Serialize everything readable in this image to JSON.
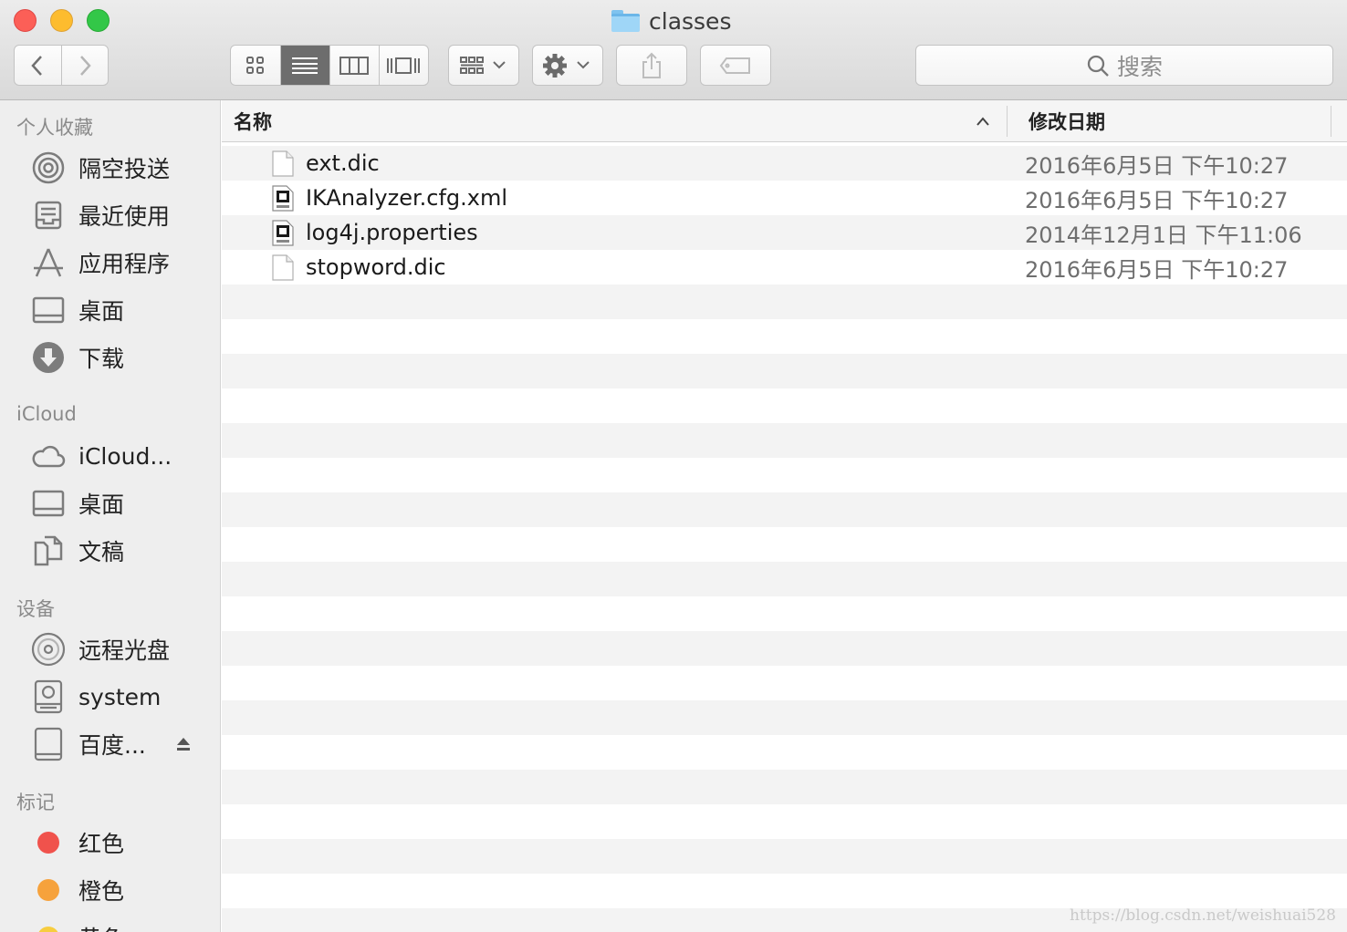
{
  "window": {
    "title": "classes"
  },
  "toolbar": {
    "back_icon": "chevron-left-icon",
    "forward_icon": "chevron-right-icon",
    "view_modes": [
      "icon-view",
      "list-view",
      "column-view",
      "cover-flow-view"
    ],
    "active_view": "list-view",
    "arrange_icon": "arrange-grid-icon",
    "action_icon": "gear-icon",
    "share_icon": "share-icon",
    "tag_icon": "tag-icon",
    "search_placeholder": "搜索"
  },
  "sidebar": {
    "favorites_title": "个人收藏",
    "favorites": [
      {
        "label": "隔空投送",
        "icon": "airdrop-icon"
      },
      {
        "label": "最近使用",
        "icon": "recents-icon"
      },
      {
        "label": "应用程序",
        "icon": "applications-icon"
      },
      {
        "label": "桌面",
        "icon": "desktop-icon"
      },
      {
        "label": "下载",
        "icon": "downloads-icon"
      }
    ],
    "icloud_title": "iCloud",
    "icloud": [
      {
        "label": "iCloud...",
        "icon": "icloud-icon"
      },
      {
        "label": "桌面",
        "icon": "desktop-icon"
      },
      {
        "label": "文稿",
        "icon": "documents-icon"
      }
    ],
    "devices_title": "设备",
    "devices": [
      {
        "label": "远程光盘",
        "icon": "remote-disc-icon"
      },
      {
        "label": "system",
        "icon": "hard-drive-icon"
      },
      {
        "label": "百度...",
        "icon": "external-drive-icon"
      }
    ],
    "tags_title": "标记",
    "tags": [
      {
        "label": "红色",
        "color": "#f0524c"
      },
      {
        "label": "橙色",
        "color": "#f6a23c"
      },
      {
        "label": "黄色",
        "color": "#f7cd3f"
      }
    ]
  },
  "list": {
    "col_name": "名称",
    "col_date": "修改日期",
    "sort_icon": "chevron-up-icon",
    "files": [
      {
        "name": "ext.dic",
        "date": "2016年6月5日 下午10:27",
        "icon": "plain-file-icon"
      },
      {
        "name": "IKAnalyzer.cfg.xml",
        "date": "2016年6月5日 下午10:27",
        "icon": "xml-file-icon"
      },
      {
        "name": "log4j.properties",
        "date": "2014年12月1日 下午11:06",
        "icon": "java-file-icon"
      },
      {
        "name": "stopword.dic",
        "date": "2016年6月5日 下午10:27",
        "icon": "plain-file-icon"
      }
    ]
  },
  "watermark": "https://blog.csdn.net/weishuai528"
}
